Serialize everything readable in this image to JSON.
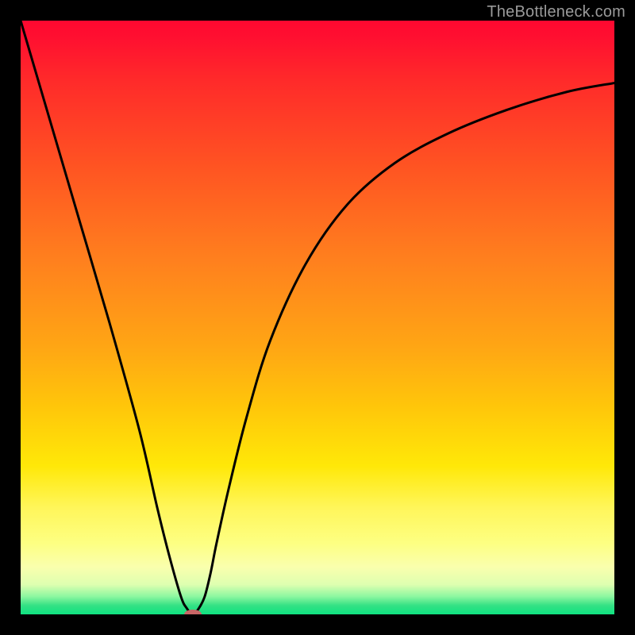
{
  "watermark": "TheBottleneck.com",
  "chart_data": {
    "type": "line",
    "title": "",
    "xlabel": "",
    "ylabel": "",
    "xlim": [
      0,
      100
    ],
    "ylim": [
      0,
      100
    ],
    "series": [
      {
        "name": "curve",
        "x": [
          0,
          5,
          10,
          15,
          20,
          23,
          25,
          27,
          28,
          29,
          30,
          31,
          32,
          33,
          35,
          38,
          42,
          48,
          55,
          63,
          72,
          82,
          92,
          100
        ],
        "y": [
          100,
          83,
          66,
          49,
          31,
          18,
          10,
          3,
          1,
          0,
          1,
          3,
          7,
          12,
          21,
          33,
          46,
          59,
          69,
          76,
          81,
          85,
          88,
          89.5
        ]
      }
    ],
    "marker": {
      "x": 29,
      "y": 0,
      "color": "#c86666"
    },
    "background_gradient": {
      "stops": [
        {
          "pos": 0.0,
          "color": "#ff0830"
        },
        {
          "pos": 0.4,
          "color": "#ff7f1e"
        },
        {
          "pos": 0.75,
          "color": "#ffe808"
        },
        {
          "pos": 0.95,
          "color": "#deffb0"
        },
        {
          "pos": 1.0,
          "color": "#0fe281"
        }
      ]
    }
  }
}
